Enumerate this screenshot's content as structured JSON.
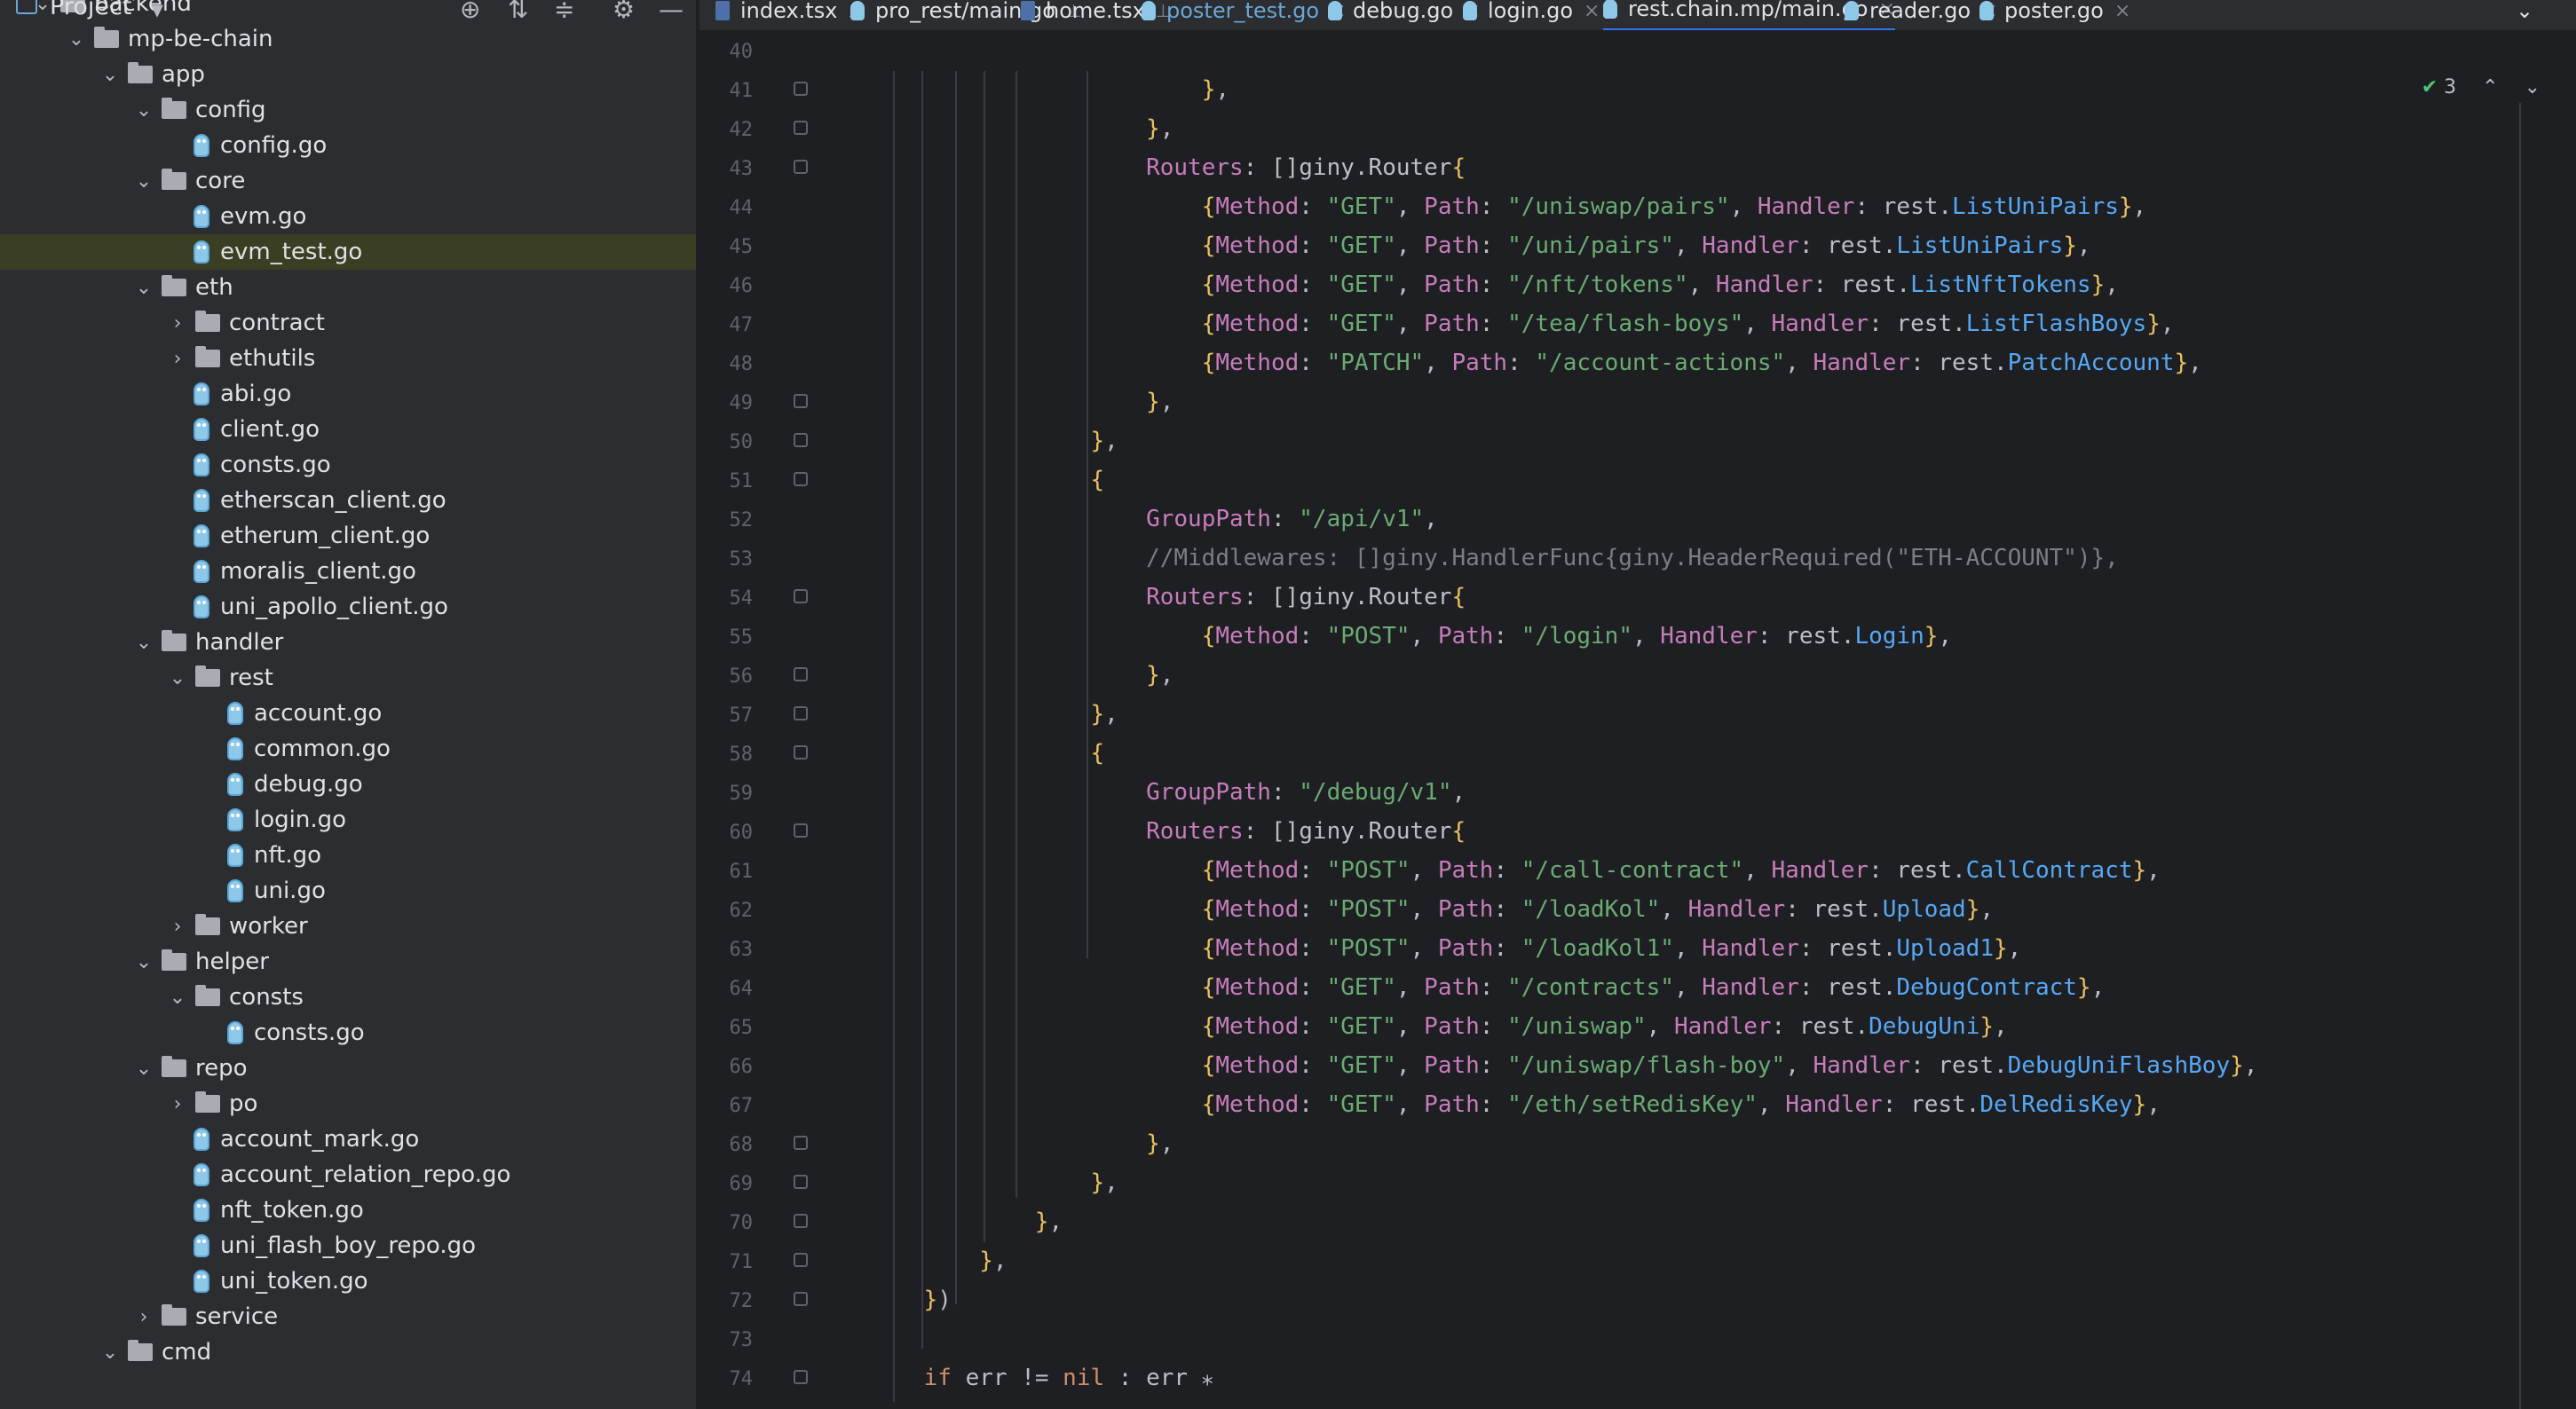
{
  "sidebar": {
    "title": "Project",
    "items": [
      {
        "label": "backend",
        "depth": 1,
        "type": "folder",
        "open": true
      },
      {
        "label": "mp-be-chain",
        "depth": 2,
        "type": "folder",
        "open": true
      },
      {
        "label": "app",
        "depth": 3,
        "type": "folder",
        "open": true
      },
      {
        "label": "config",
        "depth": 4,
        "type": "folder",
        "open": true
      },
      {
        "label": "config.go",
        "depth": 5,
        "type": "file"
      },
      {
        "label": "core",
        "depth": 4,
        "type": "folder",
        "open": true
      },
      {
        "label": "evm.go",
        "depth": 5,
        "type": "file"
      },
      {
        "label": "evm_test.go",
        "depth": 5,
        "type": "file",
        "selected": true
      },
      {
        "label": "eth",
        "depth": 4,
        "type": "folder",
        "open": true
      },
      {
        "label": "contract",
        "depth": 5,
        "type": "folder",
        "open": false
      },
      {
        "label": "ethutils",
        "depth": 5,
        "type": "folder",
        "open": false
      },
      {
        "label": "abi.go",
        "depth": 5,
        "type": "file"
      },
      {
        "label": "client.go",
        "depth": 5,
        "type": "file"
      },
      {
        "label": "consts.go",
        "depth": 5,
        "type": "file"
      },
      {
        "label": "etherscan_client.go",
        "depth": 5,
        "type": "file"
      },
      {
        "label": "etherum_client.go",
        "depth": 5,
        "type": "file"
      },
      {
        "label": "moralis_client.go",
        "depth": 5,
        "type": "file"
      },
      {
        "label": "uni_apollo_client.go",
        "depth": 5,
        "type": "file"
      },
      {
        "label": "handler",
        "depth": 4,
        "type": "folder",
        "open": true
      },
      {
        "label": "rest",
        "depth": 5,
        "type": "folder",
        "open": true
      },
      {
        "label": "account.go",
        "depth": 6,
        "type": "file"
      },
      {
        "label": "common.go",
        "depth": 6,
        "type": "file"
      },
      {
        "label": "debug.go",
        "depth": 6,
        "type": "file"
      },
      {
        "label": "login.go",
        "depth": 6,
        "type": "file"
      },
      {
        "label": "nft.go",
        "depth": 6,
        "type": "file"
      },
      {
        "label": "uni.go",
        "depth": 6,
        "type": "file"
      },
      {
        "label": "worker",
        "depth": 5,
        "type": "folder",
        "open": false
      },
      {
        "label": "helper",
        "depth": 4,
        "type": "folder",
        "open": true
      },
      {
        "label": "consts",
        "depth": 5,
        "type": "folder",
        "open": true
      },
      {
        "label": "consts.go",
        "depth": 6,
        "type": "file"
      },
      {
        "label": "repo",
        "depth": 4,
        "type": "folder",
        "open": true
      },
      {
        "label": "po",
        "depth": 5,
        "type": "folder",
        "open": false
      },
      {
        "label": "account_mark.go",
        "depth": 5,
        "type": "file"
      },
      {
        "label": "account_relation_repo.go",
        "depth": 5,
        "type": "file"
      },
      {
        "label": "nft_token.go",
        "depth": 5,
        "type": "file"
      },
      {
        "label": "uni_flash_boy_repo.go",
        "depth": 5,
        "type": "file"
      },
      {
        "label": "uni_token.go",
        "depth": 5,
        "type": "file"
      },
      {
        "label": "service",
        "depth": 4,
        "type": "folder",
        "open": false
      },
      {
        "label": "cmd",
        "depth": 3,
        "type": "folder",
        "open": true
      }
    ]
  },
  "tabs": [
    {
      "label": "index.tsx",
      "icon": "tsx",
      "pinned": true
    },
    {
      "label": "pro_rest/main.go",
      "icon": "go",
      "pinned": true
    },
    {
      "label": "home.tsx",
      "icon": "tsx",
      "pinned": true
    },
    {
      "label": "poster_test.go",
      "icon": "go",
      "closable": true,
      "color": "#6aa7d6"
    },
    {
      "label": "debug.go",
      "icon": "go",
      "closable": true
    },
    {
      "label": "login.go",
      "icon": "go",
      "closable": true
    },
    {
      "label": "rest.chain.mp/main.go",
      "icon": "go",
      "closable": true,
      "active": true
    },
    {
      "label": "reader.go",
      "icon": "go",
      "closable": true
    },
    {
      "label": "poster.go",
      "icon": "go",
      "closable": true
    }
  ],
  "editor": {
    "inspection_count": "3",
    "lines": [
      {
        "n": "40",
        "html": ""
      },
      {
        "n": "41",
        "html": "                        },"
      },
      {
        "n": "42",
        "html": "                    },"
      },
      {
        "n": "43",
        "html": "                    Routers: []giny.Router{"
      },
      {
        "n": "44",
        "html": "                        {Method: \"GET\", Path: \"/uniswap/pairs\", Handler: rest.ListUniPairs},"
      },
      {
        "n": "45",
        "html": "                        {Method: \"GET\", Path: \"/uni/pairs\", Handler: rest.ListUniPairs},"
      },
      {
        "n": "46",
        "html": "                        {Method: \"GET\", Path: \"/nft/tokens\", Handler: rest.ListNftTokens},"
      },
      {
        "n": "47",
        "html": "                        {Method: \"GET\", Path: \"/tea/flash-boys\", Handler: rest.ListFlashBoys},"
      },
      {
        "n": "48",
        "html": "                        {Method: \"PATCH\", Path: \"/account-actions\", Handler: rest.PatchAccount},"
      },
      {
        "n": "49",
        "html": "                    },"
      },
      {
        "n": "50",
        "html": "                },"
      },
      {
        "n": "51",
        "html": "                {"
      },
      {
        "n": "52",
        "html": "                    GroupPath: \"/api/v1\","
      },
      {
        "n": "53",
        "html": "                    //Middlewares: []giny.HandlerFunc{giny.HeaderRequired(\"ETH-ACCOUNT\")},"
      },
      {
        "n": "54",
        "html": "                    Routers: []giny.Router{"
      },
      {
        "n": "55",
        "html": "                        {Method: \"POST\", Path: \"/login\", Handler: rest.Login},"
      },
      {
        "n": "56",
        "html": "                    },"
      },
      {
        "n": "57",
        "html": "                },"
      },
      {
        "n": "58",
        "html": "                {"
      },
      {
        "n": "59",
        "html": "                    GroupPath: \"/debug/v1\","
      },
      {
        "n": "60",
        "html": "                    Routers: []giny.Router{"
      },
      {
        "n": "61",
        "html": "                        {Method: \"POST\", Path: \"/call-contract\", Handler: rest.CallContract},"
      },
      {
        "n": "62",
        "html": "                        {Method: \"POST\", Path: \"/loadKol\", Handler: rest.Upload},"
      },
      {
        "n": "63",
        "html": "                        {Method: \"POST\", Path: \"/loadKol1\", Handler: rest.Upload1},"
      },
      {
        "n": "64",
        "html": "                        {Method: \"GET\", Path: \"/contracts\", Handler: rest.DebugContract},"
      },
      {
        "n": "65",
        "html": "                        {Method: \"GET\", Path: \"/uniswap\", Handler: rest.DebugUni},"
      },
      {
        "n": "66",
        "html": "                        {Method: \"GET\", Path: \"/uniswap/flash-boy\", Handler: rest.DebugUniFlashBoy},"
      },
      {
        "n": "67",
        "html": "                        {Method: \"GET\", Path: \"/eth/setRedisKey\", Handler: rest.DelRedisKey},"
      },
      {
        "n": "68",
        "html": "                    },"
      },
      {
        "n": "69",
        "html": "                },"
      },
      {
        "n": "70",
        "html": "            },"
      },
      {
        "n": "71",
        "html": "        },"
      },
      {
        "n": "72",
        "html": "    })"
      },
      {
        "n": "73",
        "html": ""
      },
      {
        "n": "74",
        "html": "    if err != nil : err ⁎"
      }
    ]
  }
}
